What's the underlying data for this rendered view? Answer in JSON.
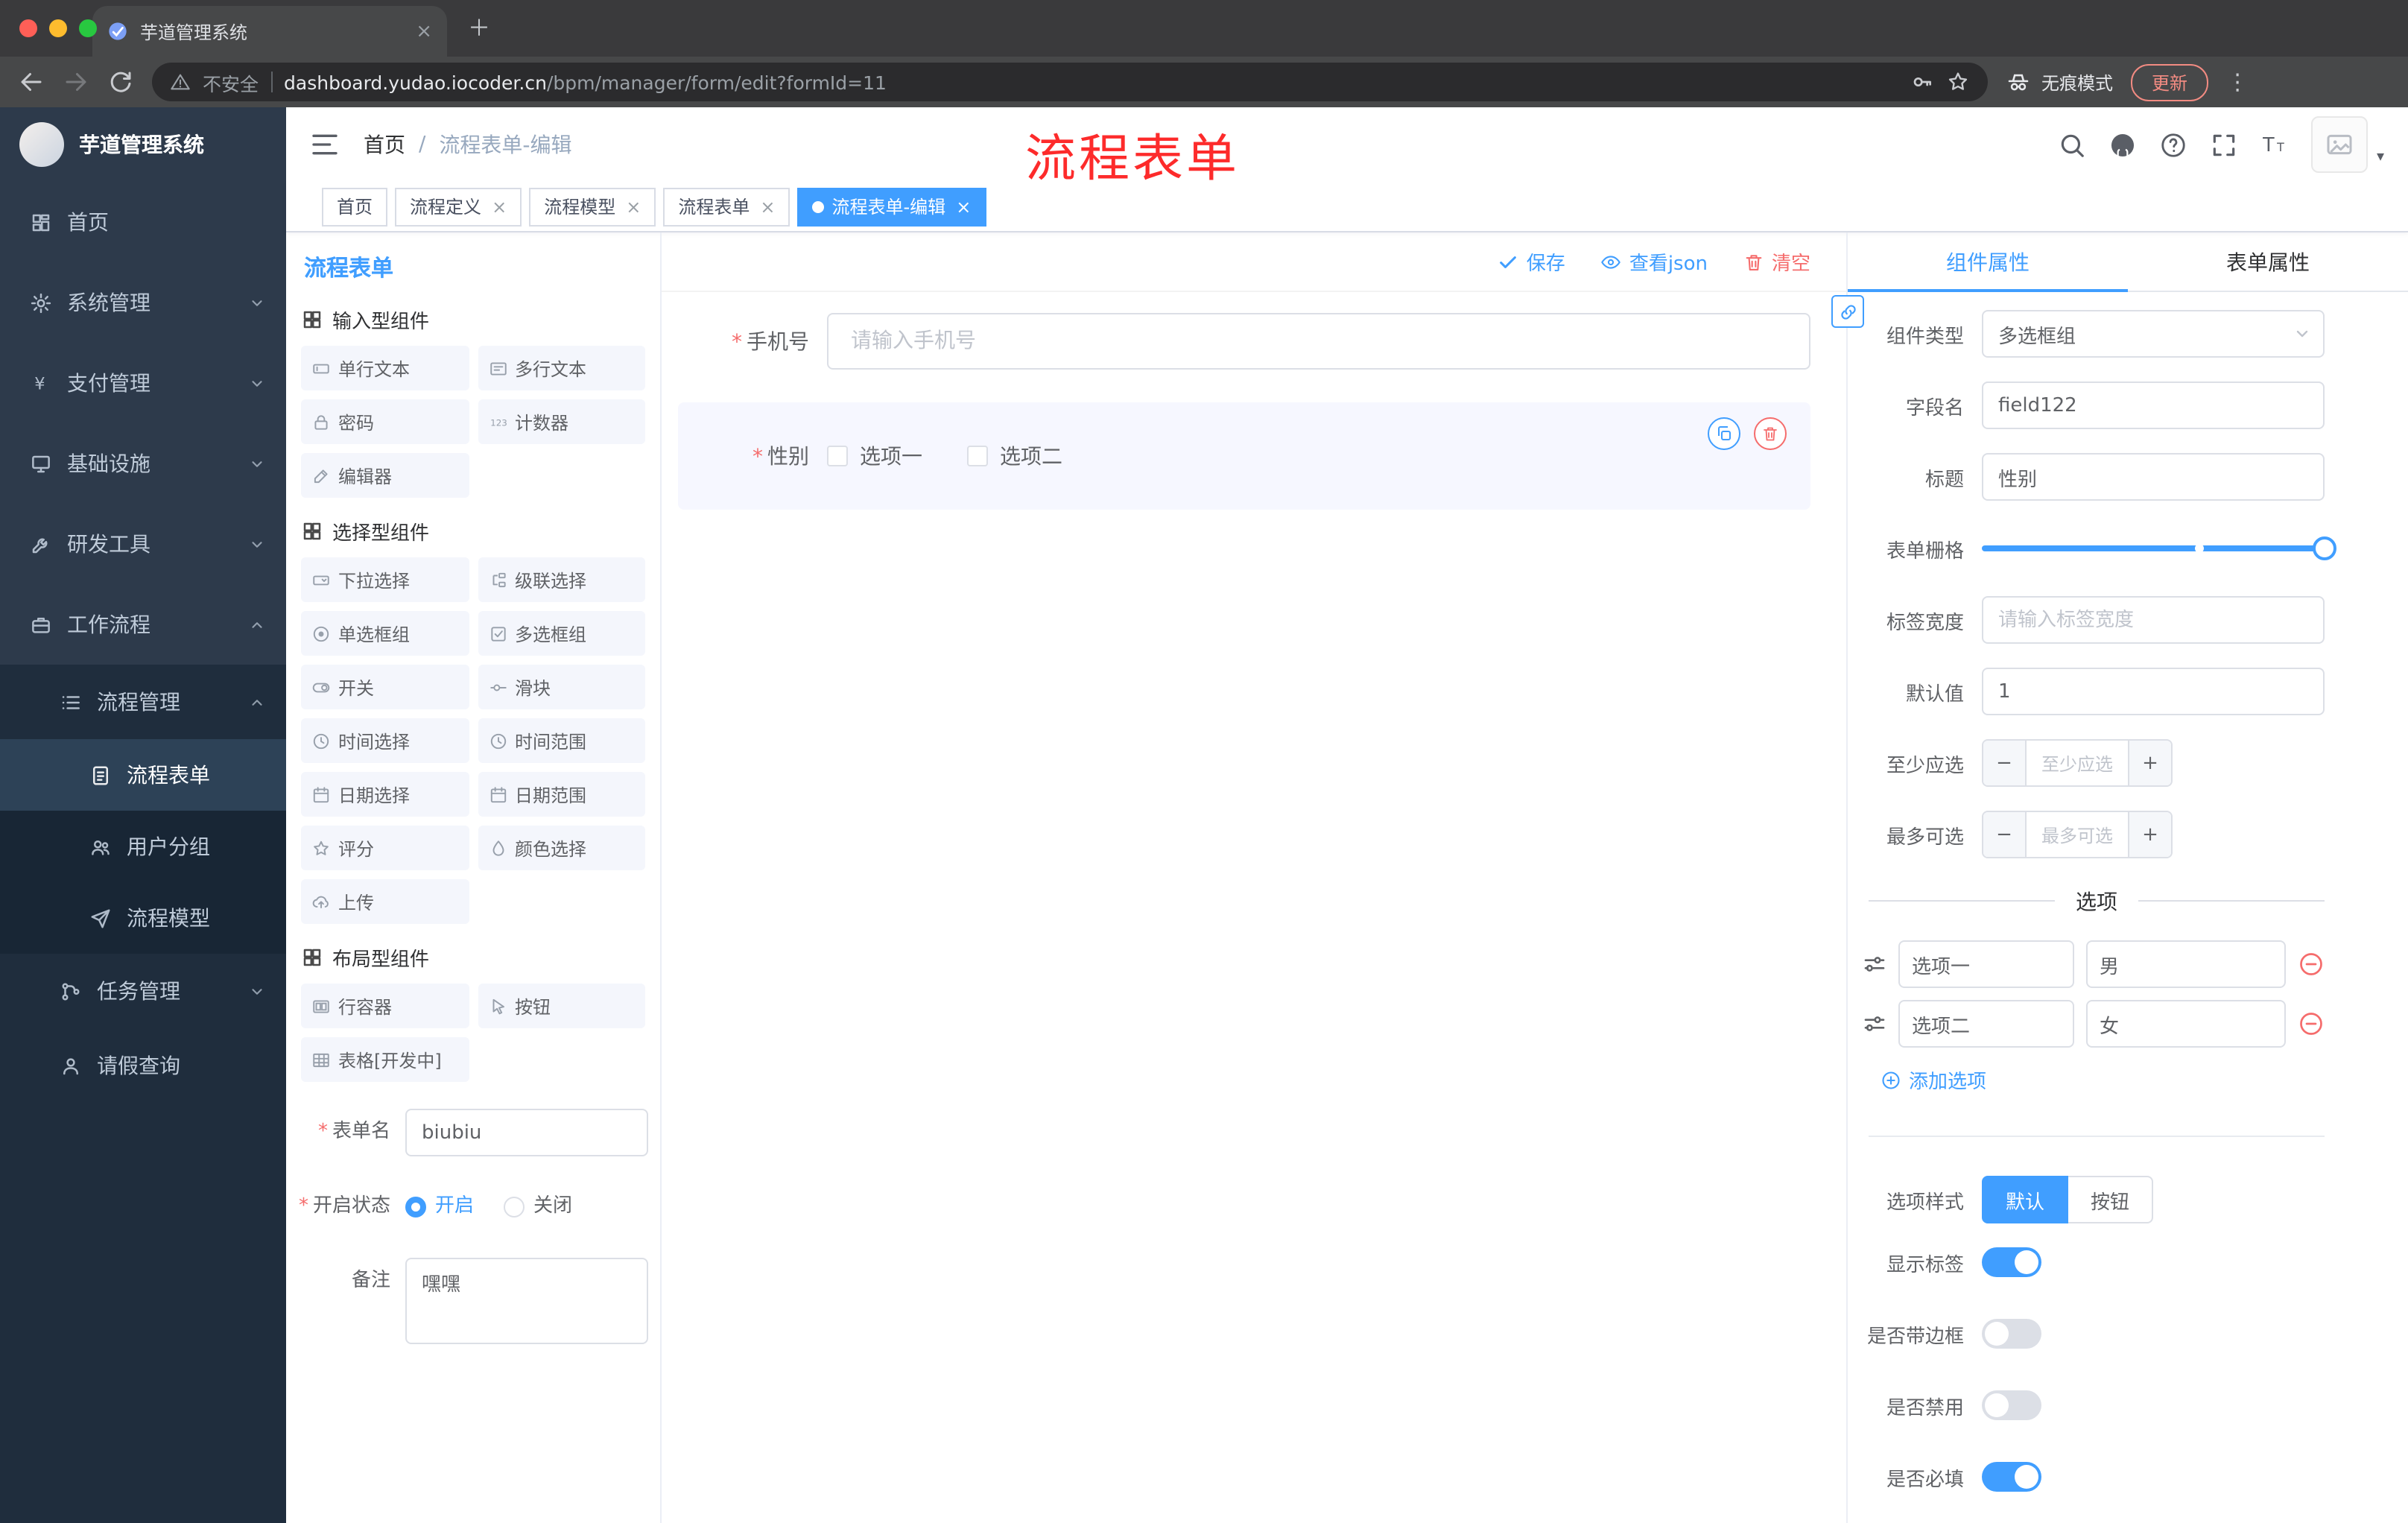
{
  "glyphs": {
    "asterisk": "*",
    "slash": "/",
    "close": "×",
    "plus": "＋",
    "dots": "⋮",
    "minus": "−",
    "plus_small": "+",
    "caret": "▾"
  },
  "colors": {
    "accent": "#409eff",
    "danger": "#f56c6c"
  },
  "browser": {
    "tab_title": "芋道管理系统",
    "security": "不安全",
    "url_domain": "dashboard.yudao.iocoder.cn",
    "url_path": "/bpm/manager/form/edit?formId=11",
    "incognito": "无痕模式",
    "update": "更新"
  },
  "sidebar": {
    "logo": "芋道管理系统",
    "items": [
      {
        "label": "首页"
      },
      {
        "label": "系统管理"
      },
      {
        "label": "支付管理"
      },
      {
        "label": "基础设施"
      },
      {
        "label": "研发工具"
      },
      {
        "label": "工作流程"
      },
      {
        "label": "流程管理"
      },
      {
        "label": "流程表单"
      },
      {
        "label": "用户分组"
      },
      {
        "label": "流程模型"
      },
      {
        "label": "任务管理"
      },
      {
        "label": "请假查询"
      }
    ]
  },
  "header": {
    "breadcrumb_home": "首页",
    "breadcrumb_current": "流程表单-编辑",
    "annotation": "流程表单"
  },
  "tags": [
    {
      "label": "首页"
    },
    {
      "label": "流程定义"
    },
    {
      "label": "流程模型"
    },
    {
      "label": "流程表单"
    },
    {
      "label": "流程表单-编辑"
    }
  ],
  "palette": {
    "title": "流程表单",
    "groups": [
      {
        "label": "输入型组件",
        "items": [
          "单行文本",
          "多行文本",
          "密码",
          "计数器",
          "编辑器"
        ]
      },
      {
        "label": "选择型组件",
        "items": [
          "下拉选择",
          "级联选择",
          "单选框组",
          "多选框组",
          "开关",
          "滑块",
          "时间选择",
          "时间范围",
          "日期选择",
          "日期范围",
          "评分",
          "颜色选择",
          "上传"
        ]
      },
      {
        "label": "布局型组件",
        "items": [
          "行容器",
          "按钮",
          "表格[开发中]"
        ]
      }
    ],
    "meta": {
      "name_label": "表单名",
      "name_value": "biubiu",
      "status_label": "开启状态",
      "status_on": "开启",
      "status_off": "关闭",
      "remark_label": "备注",
      "remark_value": "嘿嘿"
    }
  },
  "canvas": {
    "save": "保存",
    "view_json": "查看json",
    "clear": "清空",
    "phone_label": "手机号",
    "phone_placeholder": "请输入手机号",
    "gender_label": "性别",
    "gender_opt1": "选项一",
    "gender_opt2": "选项二"
  },
  "props": {
    "tab_component": "组件属性",
    "tab_form": "表单属性",
    "type_label": "组件类型",
    "type_value": "多选框组",
    "field_label": "字段名",
    "field_value": "field122",
    "title_label": "标题",
    "title_value": "性别",
    "grid_label": "表单栅格",
    "width_label": "标签宽度",
    "width_placeholder": "请输入标签宽度",
    "default_label": "默认值",
    "default_value": "1",
    "min_label": "至少应选",
    "min_placeholder": "至少应选",
    "max_label": "最多可选",
    "max_placeholder": "最多可选",
    "options_title": "选项",
    "options": [
      {
        "label": "选项一",
        "value": "男"
      },
      {
        "label": "选项二",
        "value": "女"
      }
    ],
    "add_option": "添加选项",
    "style_label": "选项样式",
    "style_default": "默认",
    "style_button": "按钮",
    "toggle_show_label": "显示标签",
    "toggle_border": "是否带边框",
    "toggle_disabled": "是否禁用",
    "toggle_required": "是否必填"
  }
}
